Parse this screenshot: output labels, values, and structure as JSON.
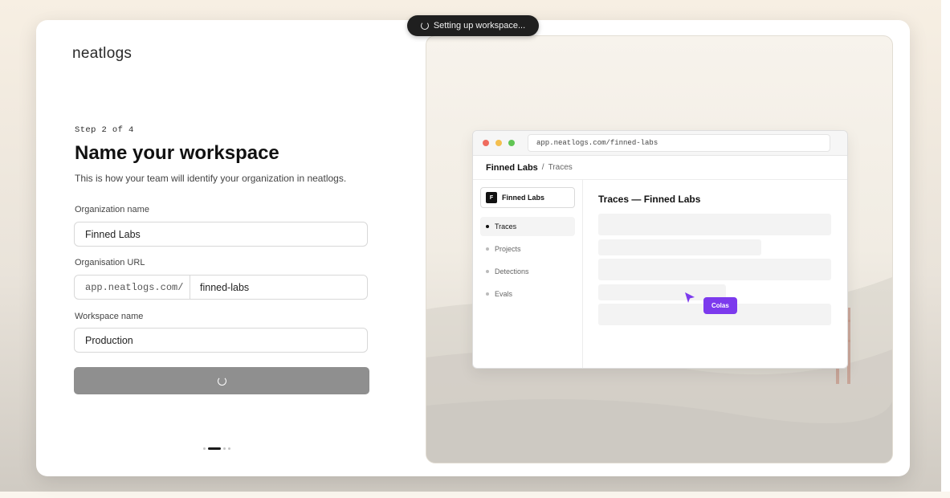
{
  "toast": {
    "label": "Setting up workspace..."
  },
  "brand": {
    "name": "neatlogs"
  },
  "form": {
    "step": "Step 2 of 4",
    "title": "Name your workspace",
    "subtitle": "This is how your team will identify your organization in neatlogs.",
    "org_name_label": "Organization name",
    "org_name_value": "Finned Labs",
    "org_url_label": "Organisation URL",
    "org_url_prefix": "app.neatlogs.com/",
    "org_url_slug": "finned-labs",
    "workspace_label": "Workspace name",
    "workspace_value": "Production",
    "submit_state": "loading",
    "progress": {
      "current_step": 2,
      "total_steps": 4
    }
  },
  "preview": {
    "address": "app.neatlogs.com/finned-labs",
    "breadcrumb": {
      "org": "Finned Labs",
      "separator": "/",
      "page": "Traces"
    },
    "org_switcher": {
      "avatar_letter": "F",
      "name": "Finned Labs"
    },
    "nav": [
      "Traces",
      "Projects",
      "Detections",
      "Evals"
    ],
    "active_nav": "Traces",
    "main_title": "Traces — Finned Labs",
    "cursor_badge": "Colas"
  },
  "colors": {
    "toast_bg": "#1f1f1f",
    "button_loading": "#8f8f8f",
    "cursor_accent": "#7c3aed",
    "traffic_red": "#ef6b5e",
    "traffic_yellow": "#f4bf4f",
    "traffic_green": "#61c554"
  }
}
